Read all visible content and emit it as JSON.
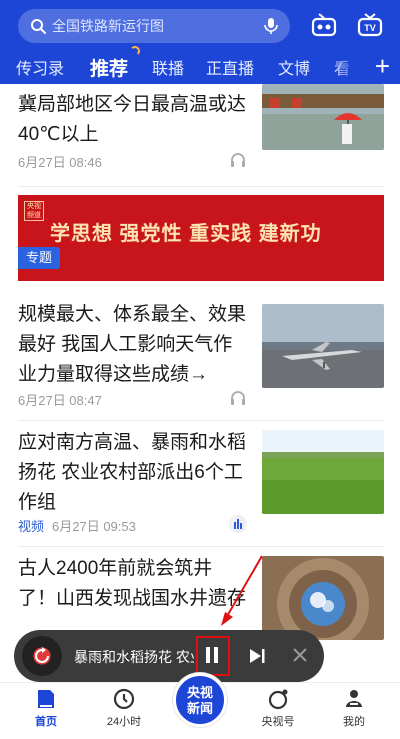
{
  "search": {
    "placeholder": "全国铁路新运行图"
  },
  "nav": {
    "tabs": [
      {
        "label": "传习录"
      },
      {
        "label": "推荐"
      },
      {
        "label": "联播"
      },
      {
        "label": "正直播"
      },
      {
        "label": "文博"
      },
      {
        "label": "看"
      }
    ],
    "plus": "+"
  },
  "feed": {
    "items": [
      {
        "title": "冀局部地区今日最高温或达40℃以上",
        "date": "6月27日 08:46",
        "tag": ""
      },
      {
        "title": "规模最大、体系最全、效果最好 我国人工影响天气作业力量取得这些成绩→",
        "date": "6月27日 08:47",
        "tag": ""
      },
      {
        "title": "应对南方高温、暴雨和水稻扬花 农业农村部派出6个工作组",
        "date": "6月27日 09:53",
        "tag": "视频"
      },
      {
        "title": "古人2400年前就会筑井了！山西发现战国水井遗存",
        "date": "",
        "tag": ""
      }
    ],
    "banner": {
      "logo": "央视频道",
      "slogan": "学思想 强党性 重实践 建新功",
      "badge": "专题"
    }
  },
  "player": {
    "title": "暴雨和水稻扬花 农业"
  },
  "bottom_nav": {
    "items": [
      {
        "label": "首页"
      },
      {
        "label": "24小时"
      },
      {
        "label": "央视新闻"
      },
      {
        "label": "央视号"
      },
      {
        "label": "我的"
      }
    ],
    "center_line1": "央视",
    "center_line2": "新闻"
  },
  "colors": {
    "brand_blue": "#1e46d6",
    "banner_red": "#c8141b",
    "highlight_red": "#e01010"
  }
}
